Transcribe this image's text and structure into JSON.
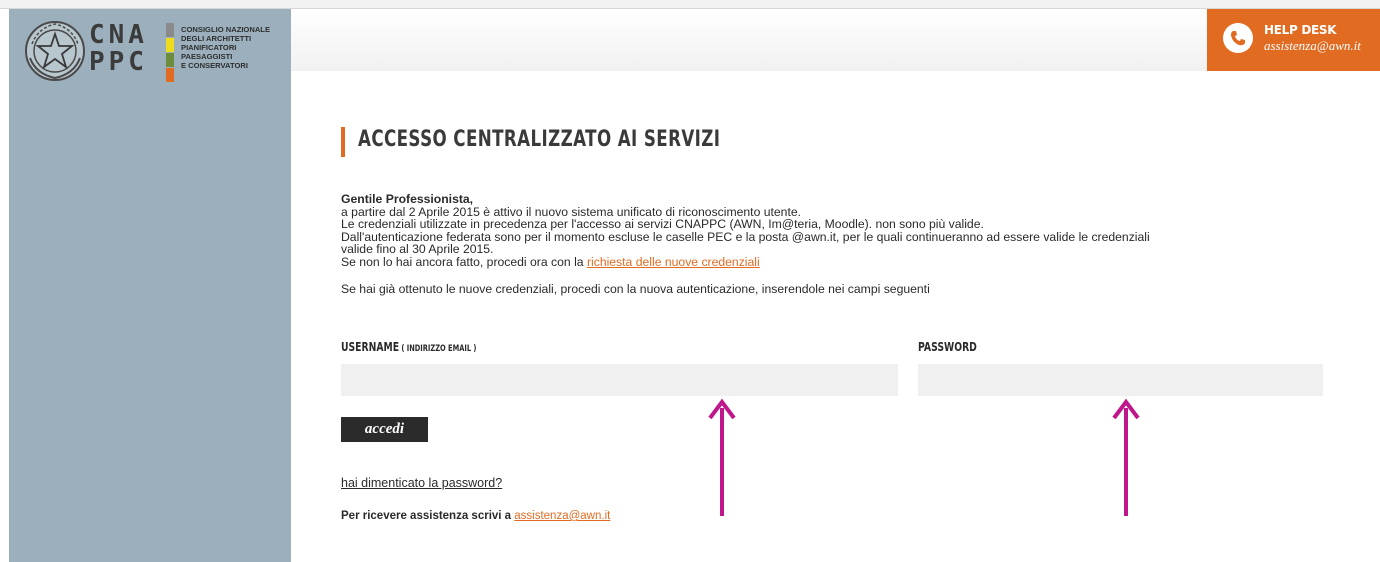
{
  "logo": {
    "letters_row1": "CNA",
    "letters_row2": "PPC",
    "text_lines": [
      "CONSIGLIO NAZIONALE",
      "DEGLI ARCHITETTI",
      "PIANIFICATORI",
      "PAESAGGISTI",
      "E CONSERVATORI"
    ],
    "bar_colors": [
      "#8a8a8a",
      "#f0dc1e",
      "#6d8c3c",
      "#e26b22"
    ]
  },
  "helpdesk": {
    "title": "HELP DESK",
    "email": "assistenza@awn.it"
  },
  "page": {
    "title": "ACCESSO CENTRALIZZATO AI SERVIZI",
    "greeting": "Gentile Professionista,",
    "line1": "a partire dal 2 Aprile 2015 è attivo il nuovo sistema unificato di riconoscimento utente.",
    "line2": "Le credenziali utilizzate in precedenza per l'accesso ai servizi CNAPPC (AWN, Im@teria, Moodle). non sono più valide.",
    "line3": "Dall'autenticazione federata sono per il momento escluse le caselle PEC e la posta @awn.it, per le quali continueranno ad essere valide le credenziali",
    "line4": "valide fino al 30 Aprile 2015.",
    "line5_prefix": "Se non lo hai ancora fatto, procedi ora con la ",
    "line5_link": "richiesta delle nuove credenziali",
    "line6": "Se hai già ottenuto le nuove credenziali, procedi con la nuova autenticazione, inserendole nei campi seguenti"
  },
  "form": {
    "username_label": "USERNAME",
    "username_hint": " ( INDIRIZZO EMAIL )",
    "username_value": "",
    "password_label": "PASSWORD",
    "password_value": "",
    "submit_label": "accedi"
  },
  "footer": {
    "forgot_link": "hai dimenticato la password?",
    "assist_prefix": "Per ricevere assistenza scrivi a ",
    "assist_link": "assistenza@awn.it"
  },
  "colors": {
    "accent": "#e26b22",
    "sidebar": "#9bb0bc",
    "annotation_arrow": "#c0168c"
  }
}
